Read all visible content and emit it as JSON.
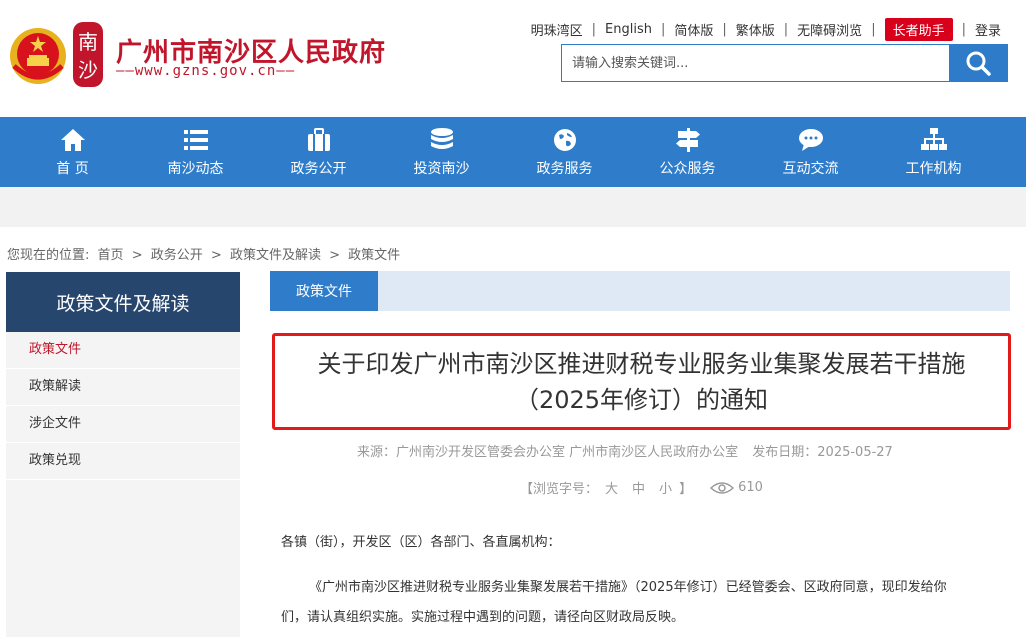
{
  "header": {
    "title": "广州市南沙区人民政府",
    "url_text": "——www.gzns.gov.cn——",
    "logo_char_top": "南",
    "logo_char_bottom": "沙"
  },
  "toplinks": {
    "mingzhu": "明珠湾区",
    "english": "English",
    "simplified": "简体版",
    "traditional": "繁体版",
    "accessible": "无障碍浏览",
    "elder": "长者助手",
    "login": "登录",
    "sep": "|"
  },
  "search": {
    "placeholder": "请输入搜索关键词..."
  },
  "nav": {
    "home": "首 页",
    "news": "南沙动态",
    "open": "政务公开",
    "invest": "投资南沙",
    "service": "政务服务",
    "public": "公众服务",
    "interact": "互动交流",
    "org": "工作机构"
  },
  "breadcrumb": {
    "prefix": "您现在的位置:",
    "home": "首页",
    "gt": ">",
    "open": "政务公开",
    "docs": "政策文件及解读",
    "current": "政策文件"
  },
  "sidebar": {
    "title": "政策文件及解读",
    "items": [
      "政策文件",
      "政策解读",
      "涉企文件",
      "政策兑现"
    ]
  },
  "content": {
    "tab": "政策文件",
    "title_line1": "关于印发广州市南沙区推进财税专业服务业集聚发展若干措施",
    "title_line2": "（2025年修订）的通知",
    "source": "来源：广州南沙开发区管委会办公室 广州市南沙区人民政府办公室",
    "date": "发布日期：2025-05-27",
    "font_label": "【浏览字号：",
    "font_large": "大",
    "font_medium": "中",
    "font_small": "小",
    "font_close": "】",
    "views": "610",
    "para1": "各镇（街），开发区（区）各部门、各直属机构：",
    "para2_line1": "《广州市南沙区推进财税专业服务业集聚发展若干措施》（2025年修订）已经管委会、区政府同意，现印发给你",
    "para2_line2": "们，请认真组织实施。实施过程中遇到的问题，请径向区财政局反映。"
  },
  "colors": {
    "primary": "#2f7dca",
    "brand_red": "#c0152a",
    "sidebar_head": "#27466e",
    "highlight": "#e41a1a"
  }
}
